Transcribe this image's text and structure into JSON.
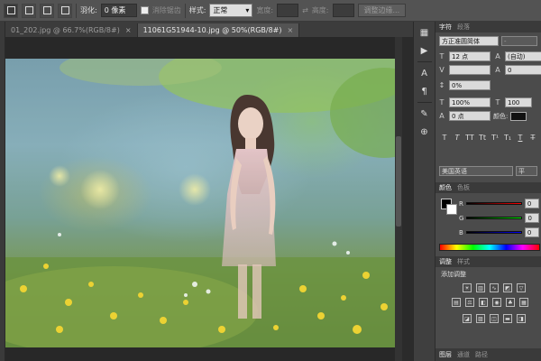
{
  "options_bar": {
    "feather_label": "羽化:",
    "feather_value": "0 像素",
    "antialias_label": "消除锯齿",
    "style_label": "样式:",
    "style_value": "正常",
    "width_label": "宽度:",
    "height_label": "高度:",
    "refine_edge_label": "调整边缘..."
  },
  "tabs": [
    {
      "label": "01_202.jpg @ 66.7%(RGB/8#)",
      "active": false
    },
    {
      "label": "11061G51944-10.jpg @ 50%(RGB/8#)",
      "active": true
    }
  ],
  "character_panel": {
    "tabs": [
      "字符",
      "段落"
    ],
    "font_family": "方正准圆简体",
    "font_style": "-",
    "font_size": "12 点",
    "leading": "(自动)",
    "kerning": "",
    "tracking": "0",
    "vertical_scale_pct": "0%",
    "scale_v": "100%",
    "scale_h": "100",
    "baseline": "0 点",
    "color_label": "颜色:",
    "style_buttons": [
      "T",
      "T",
      "TT",
      "Tt",
      "T¹",
      "T₁",
      "T",
      "T̶"
    ],
    "language": "美国英语",
    "antialias_short": "平"
  },
  "color_panel": {
    "tabs": [
      "颜色",
      "色板"
    ],
    "channels": [
      {
        "label": "R",
        "value": "0",
        "color": "#d81b1b"
      },
      {
        "label": "G",
        "value": "0",
        "color": "#1bb41b"
      },
      {
        "label": "B",
        "value": "0",
        "color": "#1b3fd8"
      }
    ]
  },
  "adjustments_panel": {
    "tabs": [
      "调整",
      "样式"
    ],
    "title": "添加调整"
  },
  "layers_panel": {
    "tabs": [
      "图层",
      "通道",
      "路径"
    ]
  },
  "colors": {
    "chrome": "#535353",
    "panel": "#4b4b4b",
    "dark": "#2b2b2b"
  }
}
